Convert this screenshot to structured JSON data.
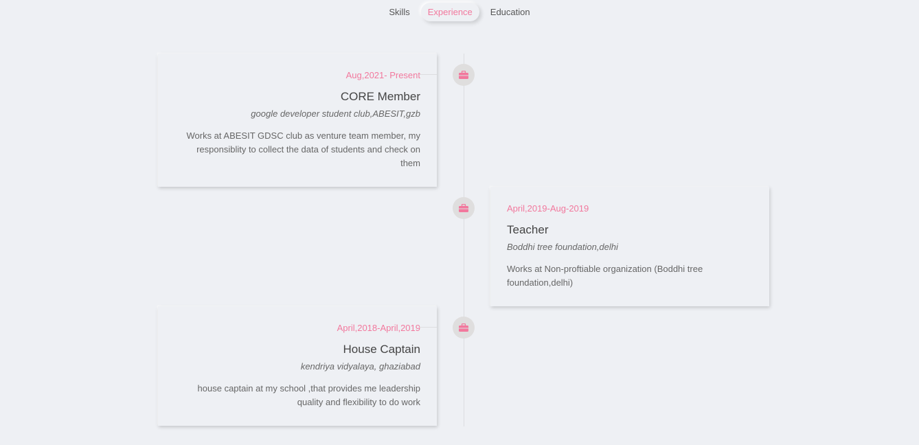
{
  "tabs": [
    {
      "label": "Skills",
      "active": false
    },
    {
      "label": "Experience",
      "active": true
    },
    {
      "label": "Education",
      "active": false
    }
  ],
  "experience": [
    {
      "date": "Aug,2021- Present",
      "title": "CORE Member",
      "org": "google developer student club,ABESIT,gzb",
      "description": "Works at ABESIT GDSC club as venture team member, my responsiblity to collect the data of students and check on them",
      "icon": "briefcase-icon"
    },
    {
      "date": "April,2019-Aug-2019",
      "title": "Teacher",
      "org": "Boddhi tree foundation,delhi",
      "description": "Works at Non-proftiable organization (Boddhi tree foundation,delhi)",
      "icon": "briefcase-icon"
    },
    {
      "date": "April,2018-April,2019",
      "title": "House Captain",
      "org": "kendriya vidyalaya, ghaziabad",
      "description": "house captain at my school ,that provides me leadership quality and flexibility to do work",
      "icon": "briefcase-icon"
    }
  ],
  "colors": {
    "accent": "#f2789d",
    "background": "#eef0f4",
    "dot": "#dfdede"
  }
}
